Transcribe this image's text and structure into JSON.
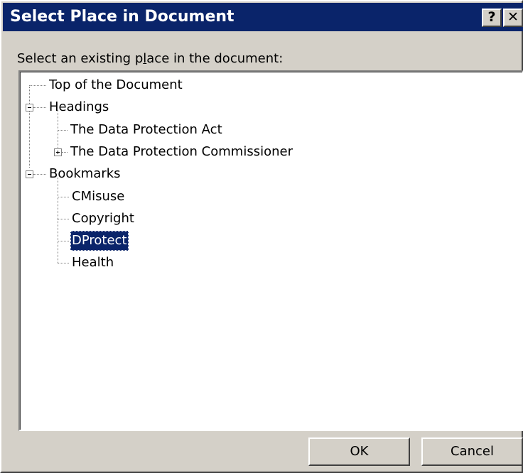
{
  "window": {
    "title": "Select Place in Document",
    "help_glyph": "?",
    "close_glyph": "✕"
  },
  "prompt": {
    "before": "Select an existing p",
    "accel": "l",
    "after": "ace in the document:"
  },
  "tree": {
    "top": "Top of the Document",
    "headings": {
      "label": "Headings",
      "children": [
        "The Data Protection Act",
        "The Data Protection Commissioner"
      ]
    },
    "bookmarks": {
      "label": "Bookmarks",
      "children": [
        "CMisuse",
        "Copyright",
        "DProtect",
        "Health"
      ],
      "selected": "DProtect"
    }
  },
  "buttons": {
    "ok": "OK",
    "cancel": "Cancel"
  }
}
